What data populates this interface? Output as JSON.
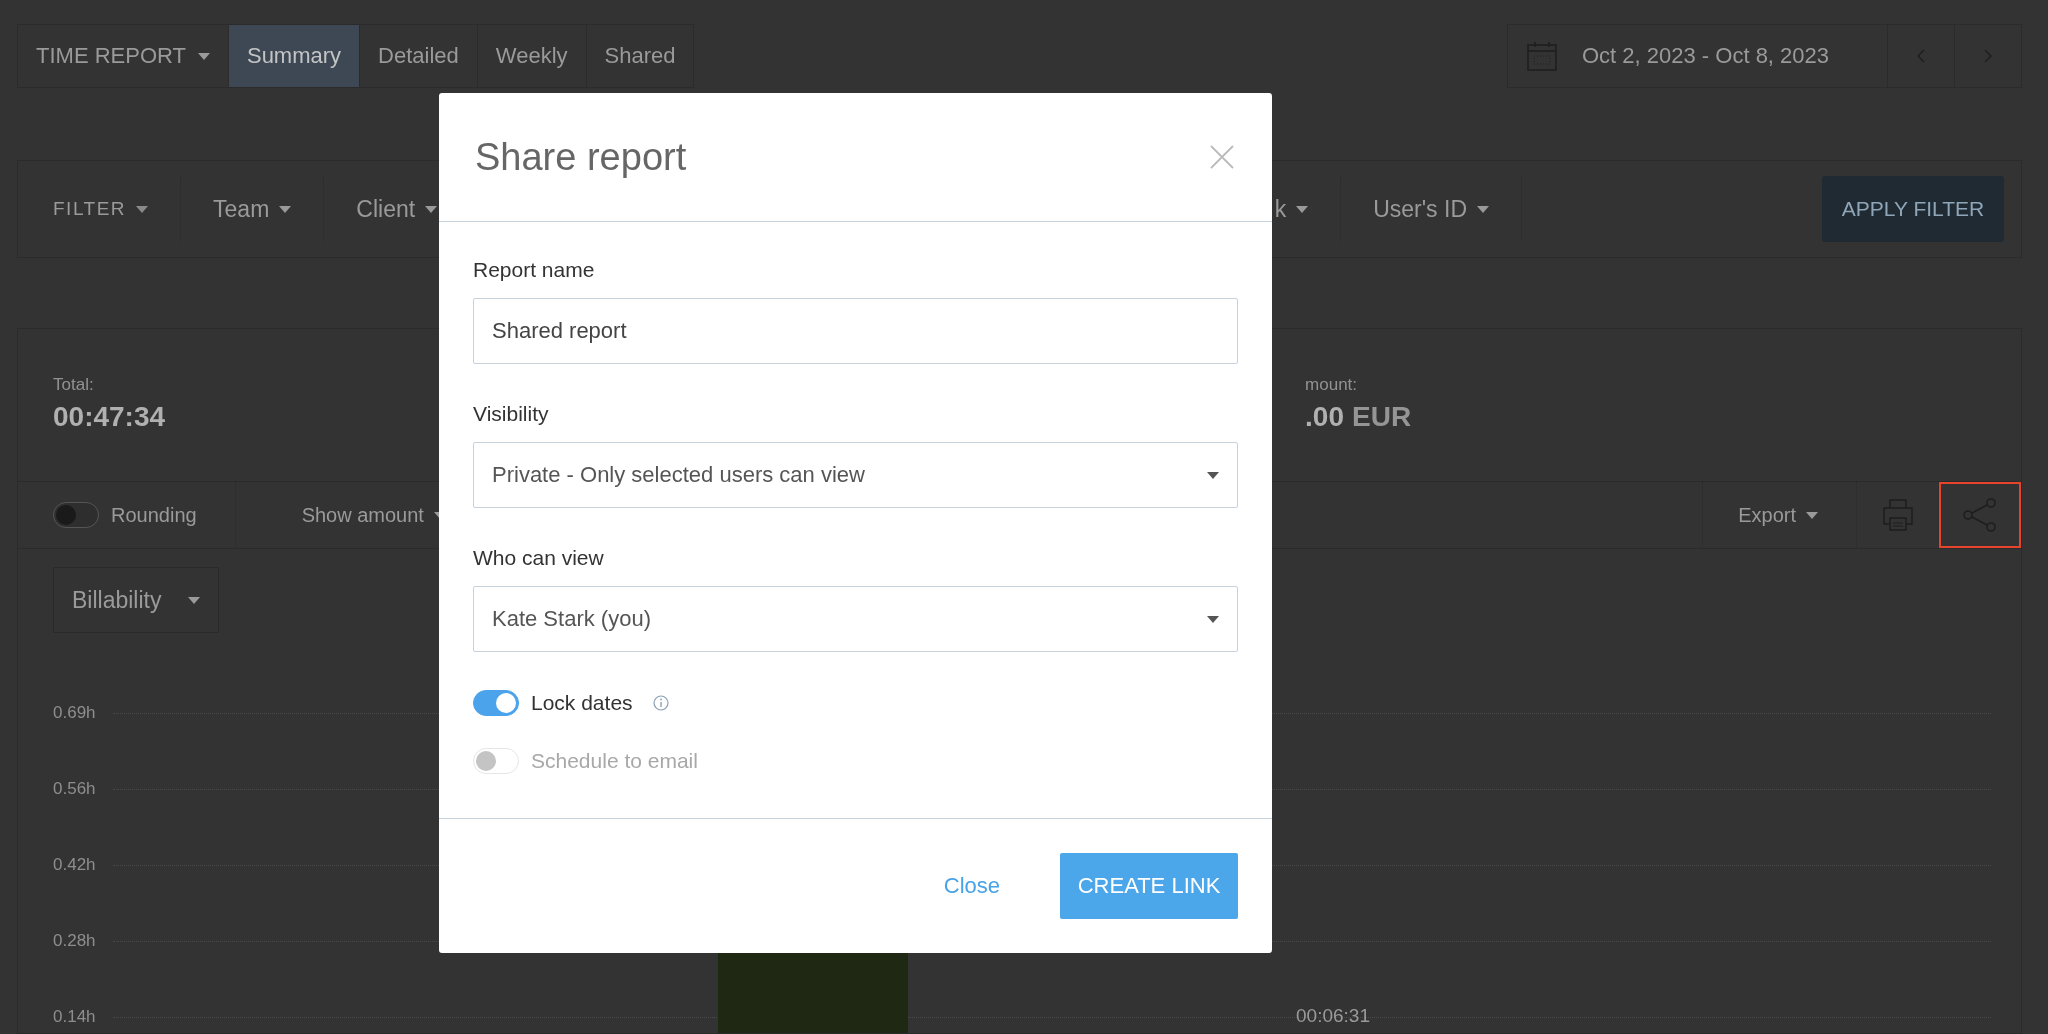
{
  "header": {
    "report_menu": "TIME REPORT",
    "tabs": [
      {
        "label": "Summary",
        "selected": true
      },
      {
        "label": "Detailed",
        "selected": false
      },
      {
        "label": "Weekly",
        "selected": false
      },
      {
        "label": "Shared",
        "selected": false
      }
    ],
    "date_range": "Oct 2, 2023 - Oct 8, 2023"
  },
  "filter_bar": {
    "filters": [
      {
        "kind": "main",
        "label": "FILTER"
      },
      {
        "kind": "field",
        "label": "Team"
      },
      {
        "kind": "field",
        "label": "Client"
      },
      {
        "kind": "field",
        "label": "k"
      },
      {
        "kind": "field",
        "label": "User's ID"
      }
    ],
    "apply_button": "APPLY FILTER"
  },
  "summary": {
    "total_label": "Total:",
    "total_value": "00:47:34",
    "amount_label": "mount:",
    "amount_value": ".00",
    "amount_currency": "EUR"
  },
  "toolbar": {
    "rounding": {
      "label": "Rounding",
      "on": false
    },
    "show_amount": "Show amount",
    "export": "Export"
  },
  "chart": {
    "group_by": "Billability",
    "y_ticks": [
      "0.69h",
      "0.56h",
      "0.42h",
      "0.28h",
      "0.14h"
    ],
    "bar_label": "00:06:31"
  },
  "dialog": {
    "title": "Share report",
    "fields": [
      {
        "kind": "text",
        "label": "Report name",
        "value": "Shared report"
      },
      {
        "kind": "select",
        "label": "Visibility",
        "value": "Private - Only selected users can view"
      },
      {
        "kind": "select",
        "label": "Who can view",
        "value": "Kate Stark (you)"
      }
    ],
    "toggles": [
      {
        "label": "Lock dates",
        "on": true,
        "disabled": false,
        "info": true
      },
      {
        "label": "Schedule to email",
        "on": false,
        "disabled": true,
        "info": false
      }
    ],
    "close_button": "Close",
    "create_button": "CREATE LINK"
  }
}
